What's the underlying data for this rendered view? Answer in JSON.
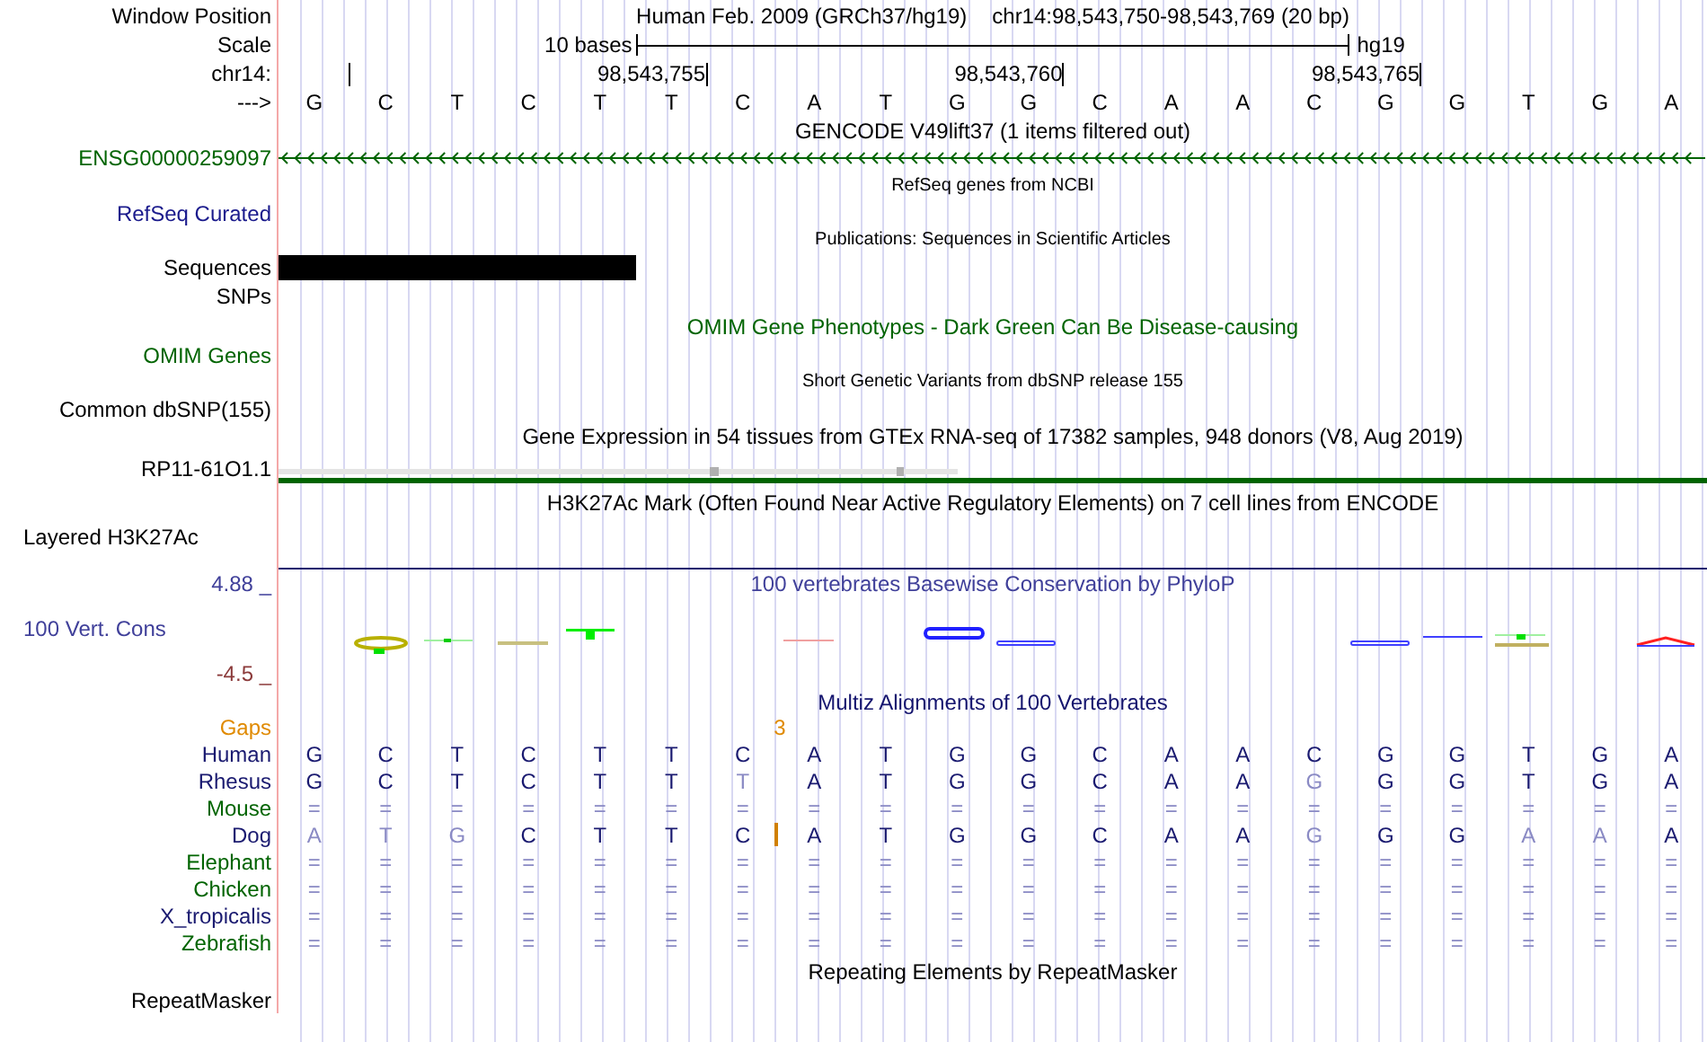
{
  "header": {
    "position_label": "Window Position",
    "assembly": "Human Feb. 2009 (GRCh37/hg19)",
    "position": "chr14:98,543,750-98,543,769 (20 bp)",
    "scale_label": "Scale",
    "scale_text": "10 bases",
    "scale_assembly": "hg19",
    "chrom_label": "chr14:",
    "ticks": [
      "98,543,755",
      "98,543,760",
      "98,543,765"
    ],
    "strand_label": "--->",
    "bases": [
      "G",
      "C",
      "T",
      "C",
      "T",
      "T",
      "C",
      "A",
      "T",
      "G",
      "G",
      "C",
      "A",
      "A",
      "C",
      "G",
      "G",
      "T",
      "G",
      "A"
    ]
  },
  "tracks": [
    {
      "kind": "gene",
      "compact": false,
      "title": {
        "text": "GENCODE V49lift37 (1 items filtered out)",
        "color": "#000000"
      },
      "labels": [
        {
          "text": "ENSG00000259097",
          "color": "#006400"
        }
      ]
    },
    {
      "kind": "plain",
      "compact": true,
      "title": {
        "text": "RefSeq genes from NCBI",
        "color": "#000000"
      },
      "labels": [
        {
          "text": "RefSeq Curated",
          "color": "#1a1a8c"
        }
      ]
    },
    {
      "kind": "bar",
      "compact": true,
      "title": {
        "text": "Publications: Sequences in Scientific Articles",
        "color": "#000000"
      },
      "labels": [
        {
          "text": "Sequences",
          "color": "#000000"
        },
        {
          "text": "SNPs",
          "color": "#000000"
        }
      ],
      "level": 0.25
    },
    {
      "kind": "plain",
      "compact": false,
      "title": {
        "text": "OMIM Gene Phenotypes - Dark Green Can Be Disease-causing",
        "color": "#006400"
      },
      "labels": [
        {
          "text": "OMIM Genes",
          "color": "#006400"
        }
      ]
    },
    {
      "kind": "plain",
      "compact": true,
      "title": {
        "text": "Short Genetic Variants from dbSNP release 155",
        "color": "#000000"
      },
      "labels": [
        {
          "text": "Common dbSNP(155)",
          "color": "#000000"
        }
      ]
    },
    {
      "kind": "gtex",
      "compact": false,
      "title": {
        "text": "Gene Expression in 54 tissues from GTEx RNA-seq of 17382 samples, 948 donors (V8, Aug 2019)",
        "color": "#000000"
      },
      "labels": [
        {
          "text": "RP11-61O1.1",
          "color": "#000000"
        }
      ]
    },
    {
      "kind": "layered",
      "compact": false,
      "title": {
        "text": "H3K27Ac Mark (Often Found Near Active Regulatory Elements) on 7 cell lines from ENCODE",
        "color": "#000000"
      },
      "labels": [
        {
          "text": "Layered H3K27Ac",
          "color": "#000000"
        }
      ]
    },
    {
      "kind": "phylop",
      "compact": false,
      "title": {
        "text": "100 vertebrates Basewise Conservation by PhyloP",
        "color": "#40409a"
      },
      "labels": [
        {
          "text": "100 Vert. Cons",
          "color": "#40409a"
        }
      ],
      "max": "4.88 _",
      "min": "-4.5 _"
    },
    {
      "kind": "multiz",
      "compact": false,
      "title": {
        "text": "Multiz Alignments of 100 Vertebrates",
        "color": "#14146e"
      },
      "labels": [
        {
          "text": "Gaps",
          "color": "#e08a00"
        }
      ],
      "gap_count": "3",
      "species": [
        {
          "name": "Human",
          "color": "#1a1a70",
          "bases": [
            {
              "text": "G",
              "faded": false
            },
            {
              "text": "C",
              "faded": false
            },
            {
              "text": "T",
              "faded": false
            },
            {
              "text": "C",
              "faded": false
            },
            {
              "text": "T",
              "faded": false
            },
            {
              "text": "T",
              "faded": false
            },
            {
              "text": "C",
              "faded": false
            },
            {
              "text": "A",
              "faded": false
            },
            {
              "text": "T",
              "faded": false
            },
            {
              "text": "G",
              "faded": false
            },
            {
              "text": "G",
              "faded": false
            },
            {
              "text": "C",
              "faded": false
            },
            {
              "text": "A",
              "faded": false
            },
            {
              "text": "A",
              "faded": false
            },
            {
              "text": "C",
              "faded": false
            },
            {
              "text": "G",
              "faded": false
            },
            {
              "text": "G",
              "faded": false
            },
            {
              "text": "T",
              "faded": false
            },
            {
              "text": "G",
              "faded": false
            },
            {
              "text": "A",
              "faded": false
            }
          ]
        },
        {
          "name": "Rhesus",
          "color": "#1a1a70",
          "bases": [
            {
              "text": "G",
              "faded": false
            },
            {
              "text": "C",
              "faded": false
            },
            {
              "text": "T",
              "faded": false
            },
            {
              "text": "C",
              "faded": false
            },
            {
              "text": "T",
              "faded": false
            },
            {
              "text": "T",
              "faded": false
            },
            {
              "text": "T",
              "faded": true
            },
            {
              "text": "A",
              "faded": false
            },
            {
              "text": "T",
              "faded": false
            },
            {
              "text": "G",
              "faded": false
            },
            {
              "text": "G",
              "faded": false
            },
            {
              "text": "C",
              "faded": false
            },
            {
              "text": "A",
              "faded": false
            },
            {
              "text": "A",
              "faded": false
            },
            {
              "text": "G",
              "faded": true
            },
            {
              "text": "G",
              "faded": false
            },
            {
              "text": "G",
              "faded": false
            },
            {
              "text": "T",
              "faded": false
            },
            {
              "text": "G",
              "faded": false
            },
            {
              "text": "A",
              "faded": false
            }
          ]
        },
        {
          "name": "Mouse",
          "color": "#006400",
          "bases": [
            {
              "text": "=",
              "faded": true
            },
            {
              "text": "=",
              "faded": true
            },
            {
              "text": "=",
              "faded": true
            },
            {
              "text": "=",
              "faded": true
            },
            {
              "text": "=",
              "faded": true
            },
            {
              "text": "=",
              "faded": true
            },
            {
              "text": "=",
              "faded": true
            },
            {
              "text": "=",
              "faded": true
            },
            {
              "text": "=",
              "faded": true
            },
            {
              "text": "=",
              "faded": true
            },
            {
              "text": "=",
              "faded": true
            },
            {
              "text": "=",
              "faded": true
            },
            {
              "text": "=",
              "faded": true
            },
            {
              "text": "=",
              "faded": true
            },
            {
              "text": "=",
              "faded": true
            },
            {
              "text": "=",
              "faded": true
            },
            {
              "text": "=",
              "faded": true
            },
            {
              "text": "=",
              "faded": true
            },
            {
              "text": "=",
              "faded": true
            },
            {
              "text": "=",
              "faded": true
            }
          ]
        },
        {
          "name": "Dog",
          "color": "#1a1a70",
          "bases": [
            {
              "text": "A",
              "faded": true
            },
            {
              "text": "T",
              "faded": true
            },
            {
              "text": "G",
              "faded": true
            },
            {
              "text": "C",
              "faded": false
            },
            {
              "text": "T",
              "faded": false
            },
            {
              "text": "T",
              "faded": false
            },
            {
              "text": "C",
              "faded": false,
              "insert_after": true
            },
            {
              "text": "A",
              "faded": false
            },
            {
              "text": "T",
              "faded": false
            },
            {
              "text": "G",
              "faded": false
            },
            {
              "text": "G",
              "faded": false
            },
            {
              "text": "C",
              "faded": false
            },
            {
              "text": "A",
              "faded": false
            },
            {
              "text": "A",
              "faded": false
            },
            {
              "text": "G",
              "faded": true
            },
            {
              "text": "G",
              "faded": false
            },
            {
              "text": "G",
              "faded": false
            },
            {
              "text": "A",
              "faded": true
            },
            {
              "text": "A",
              "faded": true
            },
            {
              "text": "A",
              "faded": false
            }
          ]
        },
        {
          "name": "Elephant",
          "color": "#006400",
          "bases": [
            {
              "text": "=",
              "faded": true
            },
            {
              "text": "=",
              "faded": true
            },
            {
              "text": "=",
              "faded": true
            },
            {
              "text": "=",
              "faded": true
            },
            {
              "text": "=",
              "faded": true
            },
            {
              "text": "=",
              "faded": true
            },
            {
              "text": "=",
              "faded": true
            },
            {
              "text": "=",
              "faded": true
            },
            {
              "text": "=",
              "faded": true
            },
            {
              "text": "=",
              "faded": true
            },
            {
              "text": "=",
              "faded": true
            },
            {
              "text": "=",
              "faded": true
            },
            {
              "text": "=",
              "faded": true
            },
            {
              "text": "=",
              "faded": true
            },
            {
              "text": "=",
              "faded": true
            },
            {
              "text": "=",
              "faded": true
            },
            {
              "text": "=",
              "faded": true
            },
            {
              "text": "=",
              "faded": true
            },
            {
              "text": "=",
              "faded": true
            },
            {
              "text": "=",
              "faded": true
            }
          ]
        },
        {
          "name": "Chicken",
          "color": "#006400",
          "bases": [
            {
              "text": "=",
              "faded": true
            },
            {
              "text": "=",
              "faded": true
            },
            {
              "text": "=",
              "faded": true
            },
            {
              "text": "=",
              "faded": true
            },
            {
              "text": "=",
              "faded": true
            },
            {
              "text": "=",
              "faded": true
            },
            {
              "text": "=",
              "faded": true
            },
            {
              "text": "=",
              "faded": true
            },
            {
              "text": "=",
              "faded": true
            },
            {
              "text": "=",
              "faded": true
            },
            {
              "text": "=",
              "faded": true
            },
            {
              "text": "=",
              "faded": true
            },
            {
              "text": "=",
              "faded": true
            },
            {
              "text": "=",
              "faded": true
            },
            {
              "text": "=",
              "faded": true
            },
            {
              "text": "=",
              "faded": true
            },
            {
              "text": "=",
              "faded": true
            },
            {
              "text": "=",
              "faded": true
            },
            {
              "text": "=",
              "faded": true
            },
            {
              "text": "=",
              "faded": true
            }
          ]
        },
        {
          "name": "X_tropicalis",
          "color": "#1a1a70",
          "bases": [
            {
              "text": "=",
              "faded": true
            },
            {
              "text": "=",
              "faded": true
            },
            {
              "text": "=",
              "faded": true
            },
            {
              "text": "=",
              "faded": true
            },
            {
              "text": "=",
              "faded": true
            },
            {
              "text": "=",
              "faded": true
            },
            {
              "text": "=",
              "faded": true
            },
            {
              "text": "=",
              "faded": true
            },
            {
              "text": "=",
              "faded": true
            },
            {
              "text": "=",
              "faded": true
            },
            {
              "text": "=",
              "faded": true
            },
            {
              "text": "=",
              "faded": true
            },
            {
              "text": "=",
              "faded": true
            },
            {
              "text": "=",
              "faded": true
            },
            {
              "text": "=",
              "faded": true
            },
            {
              "text": "=",
              "faded": true
            },
            {
              "text": "=",
              "faded": true
            },
            {
              "text": "=",
              "faded": true
            },
            {
              "text": "=",
              "faded": true
            },
            {
              "text": "=",
              "faded": true
            }
          ]
        },
        {
          "name": "Zebrafish",
          "color": "#006400",
          "bases": [
            {
              "text": "=",
              "faded": true
            },
            {
              "text": "=",
              "faded": true
            },
            {
              "text": "=",
              "faded": true
            },
            {
              "text": "=",
              "faded": true
            },
            {
              "text": "=",
              "faded": true
            },
            {
              "text": "=",
              "faded": true
            },
            {
              "text": "=",
              "faded": true
            },
            {
              "text": "=",
              "faded": true
            },
            {
              "text": "=",
              "faded": true
            },
            {
              "text": "=",
              "faded": true
            },
            {
              "text": "=",
              "faded": true
            },
            {
              "text": "=",
              "faded": true
            },
            {
              "text": "=",
              "faded": true
            },
            {
              "text": "=",
              "faded": true
            },
            {
              "text": "=",
              "faded": true
            },
            {
              "text": "=",
              "faded": true
            },
            {
              "text": "=",
              "faded": true
            },
            {
              "text": "=",
              "faded": true
            },
            {
              "text": "=",
              "faded": true
            },
            {
              "text": "=",
              "faded": true
            }
          ]
        }
      ]
    },
    {
      "kind": "plain",
      "compact": false,
      "title": {
        "text": "Repeating Elements by RepeatMasker",
        "color": "#000000"
      },
      "labels": [
        {
          "text": "RepeatMasker",
          "color": "#000000"
        }
      ]
    }
  ]
}
